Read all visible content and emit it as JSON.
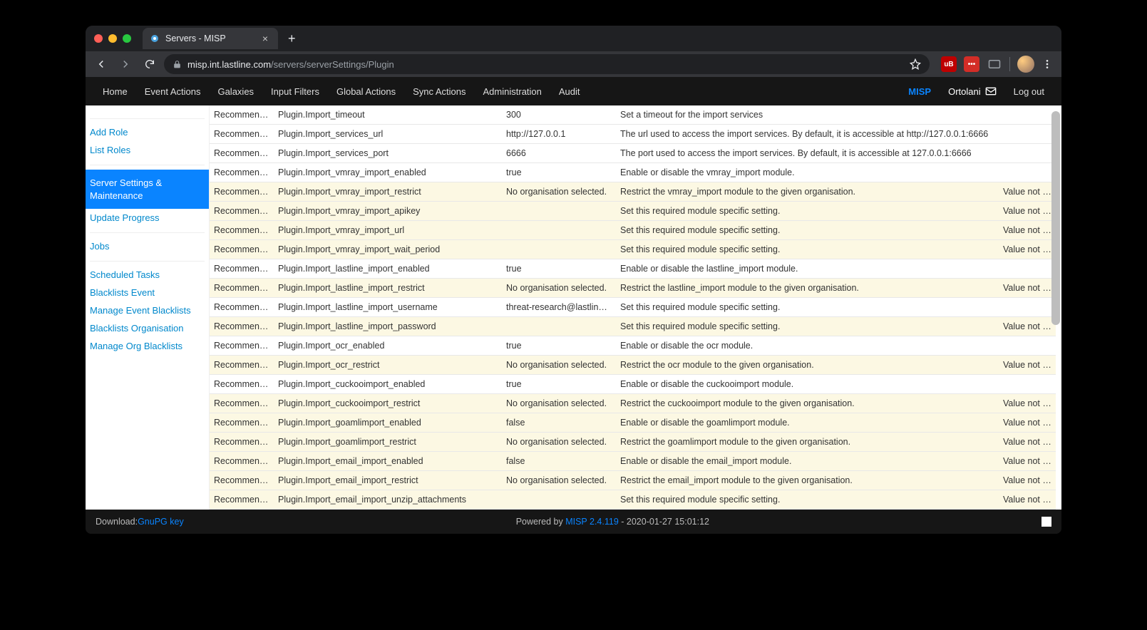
{
  "browser": {
    "tab_title": "Servers - MISP",
    "url_host": "misp.int.lastline.com",
    "url_path": "/servers/serverSettings/Plugin"
  },
  "nav": [
    "Home",
    "Event Actions",
    "Galaxies",
    "Input Filters",
    "Global Actions",
    "Sync Actions",
    "Administration",
    "Audit"
  ],
  "nav_right": {
    "brand": "MISP",
    "user": "Ortolani",
    "logout": "Log out"
  },
  "sidebar": {
    "add_role": "Add Role",
    "list_roles": "List Roles",
    "server_settings": "Server Settings & Maintenance",
    "update_progress": "Update Progress",
    "jobs": "Jobs",
    "scheduled_tasks": "Scheduled Tasks",
    "blacklists_event": "Blacklists Event",
    "manage_event_bl": "Manage Event Blacklists",
    "blacklists_org": "Blacklists Organisation",
    "manage_org_bl": "Manage Org Blacklists"
  },
  "value_not_set": "Value not set.",
  "rows": [
    {
      "prio": "Recommended",
      "key": "Plugin.Import_timeout",
      "val": "300",
      "desc": "Set a timeout for the import services",
      "warn": false,
      "unset": false
    },
    {
      "prio": "Recommended",
      "key": "Plugin.Import_services_url",
      "val": "http://127.0.0.1",
      "desc": "The url used to access the import services. By default, it is accessible at http://127.0.0.1:6666",
      "warn": false,
      "unset": false
    },
    {
      "prio": "Recommended",
      "key": "Plugin.Import_services_port",
      "val": "6666",
      "desc": "The port used to access the import services. By default, it is accessible at 127.0.0.1:6666",
      "warn": false,
      "unset": false
    },
    {
      "prio": "Recommended",
      "key": "Plugin.Import_vmray_import_enabled",
      "val": "true",
      "desc": "Enable or disable the vmray_import module.",
      "warn": false,
      "unset": false
    },
    {
      "prio": "Recommended",
      "key": "Plugin.Import_vmray_import_restrict",
      "val": "No organisation selected.",
      "desc": "Restrict the vmray_import module to the given organisation.",
      "warn": true,
      "unset": true
    },
    {
      "prio": "Recommended",
      "key": "Plugin.Import_vmray_import_apikey",
      "val": "",
      "desc": "Set this required module specific setting.",
      "warn": true,
      "unset": true
    },
    {
      "prio": "Recommended",
      "key": "Plugin.Import_vmray_import_url",
      "val": "",
      "desc": "Set this required module specific setting.",
      "warn": true,
      "unset": true
    },
    {
      "prio": "Recommended",
      "key": "Plugin.Import_vmray_import_wait_period",
      "val": "",
      "desc": "Set this required module specific setting.",
      "warn": true,
      "unset": true
    },
    {
      "prio": "Recommended",
      "key": "Plugin.Import_lastline_import_enabled",
      "val": "true",
      "desc": "Enable or disable the lastline_import module.",
      "warn": false,
      "unset": false
    },
    {
      "prio": "Recommended",
      "key": "Plugin.Import_lastline_import_restrict",
      "val": "No organisation selected.",
      "desc": "Restrict the lastline_import module to the given organisation.",
      "warn": true,
      "unset": true
    },
    {
      "prio": "Recommended",
      "key": "Plugin.Import_lastline_import_username",
      "val": "threat-research@lastline.com",
      "desc": "Set this required module specific setting.",
      "warn": false,
      "unset": false
    },
    {
      "prio": "Recommended",
      "key": "Plugin.Import_lastline_import_password",
      "val": "",
      "desc": "Set this required module specific setting.",
      "warn": true,
      "unset": true
    },
    {
      "prio": "Recommended",
      "key": "Plugin.Import_ocr_enabled",
      "val": "true",
      "desc": "Enable or disable the ocr module.",
      "warn": false,
      "unset": false
    },
    {
      "prio": "Recommended",
      "key": "Plugin.Import_ocr_restrict",
      "val": "No organisation selected.",
      "desc": "Restrict the ocr module to the given organisation.",
      "warn": true,
      "unset": true
    },
    {
      "prio": "Recommended",
      "key": "Plugin.Import_cuckooimport_enabled",
      "val": "true",
      "desc": "Enable or disable the cuckooimport module.",
      "warn": false,
      "unset": false
    },
    {
      "prio": "Recommended",
      "key": "Plugin.Import_cuckooimport_restrict",
      "val": "No organisation selected.",
      "desc": "Restrict the cuckooimport module to the given organisation.",
      "warn": true,
      "unset": true
    },
    {
      "prio": "Recommended",
      "key": "Plugin.Import_goamlimport_enabled",
      "val": "false",
      "desc": "Enable or disable the goamlimport module.",
      "warn": true,
      "unset": true
    },
    {
      "prio": "Recommended",
      "key": "Plugin.Import_goamlimport_restrict",
      "val": "No organisation selected.",
      "desc": "Restrict the goamlimport module to the given organisation.",
      "warn": true,
      "unset": true
    },
    {
      "prio": "Recommended",
      "key": "Plugin.Import_email_import_enabled",
      "val": "false",
      "desc": "Enable or disable the email_import module.",
      "warn": true,
      "unset": true
    },
    {
      "prio": "Recommended",
      "key": "Plugin.Import_email_import_restrict",
      "val": "No organisation selected.",
      "desc": "Restrict the email_import module to the given organisation.",
      "warn": true,
      "unset": true
    },
    {
      "prio": "Recommended",
      "key": "Plugin.Import_email_import_unzip_attachments",
      "val": "",
      "desc": "Set this required module specific setting.",
      "warn": true,
      "unset": true
    }
  ],
  "footer": {
    "download": "Download: ",
    "gpg": "GnuPG key",
    "powered": "Powered by ",
    "version": "MISP 2.4.119",
    "ts": " - 2020-01-27 15:01:12"
  }
}
